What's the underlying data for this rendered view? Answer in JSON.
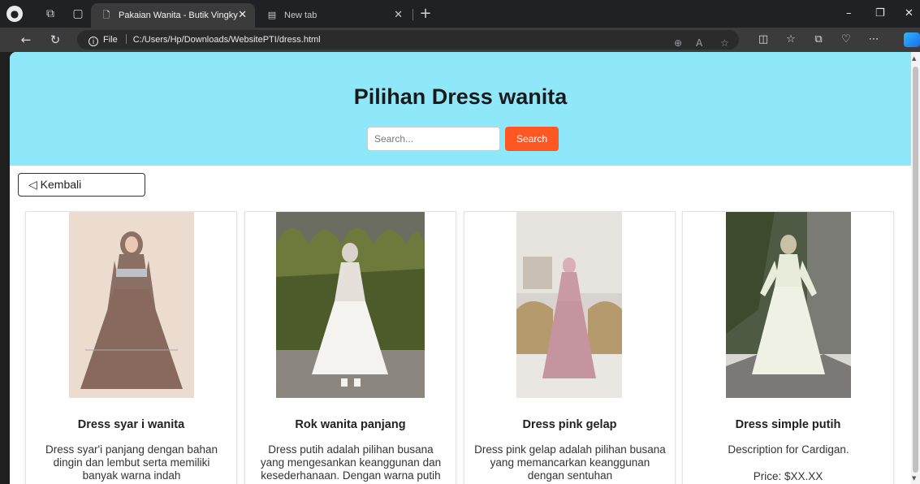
{
  "browser": {
    "tabs": [
      {
        "title": "Pakaian Wanita - Butik Vingky",
        "active": true
      },
      {
        "title": "New tab",
        "active": false
      }
    ],
    "address": {
      "scheme_label": "File",
      "url": "C:/Users/Hp/Downloads/WebsitePTI/dress.html"
    }
  },
  "page": {
    "heading": "Pilihan Dress wanita",
    "search": {
      "placeholder": "Search...",
      "button_label": "Search"
    },
    "back_label": "◁ Kembali",
    "colors": {
      "header_bg": "#8fe8fa",
      "search_button": "#ff5722"
    },
    "products": [
      {
        "title": "Dress syar i wanita",
        "description": "Dress syar'i panjang dengan bahan dingin dan lembut serta memiliki banyak warna indah",
        "image": "mauve long-sleeve hijab maxi dress"
      },
      {
        "title": "Rok wanita panjang",
        "description": "Dress putih adalah pilihan busana yang mengesankan keanggunan dan kesederhanaan. Dengan warna putih",
        "image": "white tulle skirt with lace blouse"
      },
      {
        "title": "Dress pink gelap",
        "description": "Dress pink gelap adalah pilihan busana yang memancarkan keanggunan dengan sentuhan",
        "image": "dusty pink gown in classic room"
      },
      {
        "title": "Dress simple putih",
        "description": "Description for Cardigan.",
        "price": "Price: $XX.XX",
        "image": "cream long-sleeve maxi dress"
      }
    ]
  }
}
